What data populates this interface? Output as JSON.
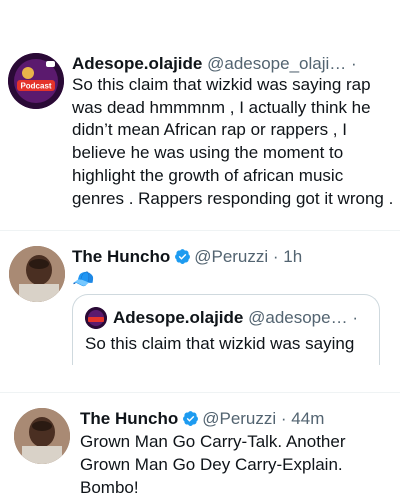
{
  "tweet1": {
    "display_name": "Adesope.olajide",
    "handle": "@adesope_olaji…",
    "dot": "·",
    "avatar_label": "Podcast",
    "text": "So this claim that wizkid was saying rap was dead hmmmnm , I actually think he didn’t mean African rap or rappers , I believe he was using the moment to highlight the growth of african music genres . Rappers responding got it wrong ."
  },
  "tweet2": {
    "display_name": "The Huncho",
    "handle": "@Peruzzi",
    "time": "· 1h",
    "emoji": "🧢",
    "quote": {
      "display_name": "Adesope.olajide",
      "handle": "@adesope…",
      "dot": "·",
      "text": "So this claim that wizkid was saying"
    }
  },
  "tweet3": {
    "display_name": "The Huncho",
    "handle": "@Peruzzi",
    "time": "· 44m",
    "text": "Grown Man Go Carry-Talk. Another Grown Man Go Dey Carry-Explain. Bombo!"
  },
  "colors": {
    "verified": "#1d9bf0",
    "secondary": "#536471",
    "primary_text": "#0f1419"
  }
}
